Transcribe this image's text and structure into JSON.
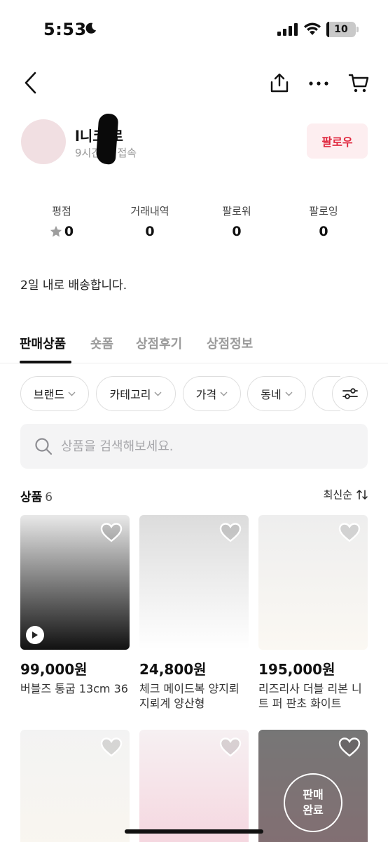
{
  "status_bar": {
    "time": "5:53",
    "battery": "10",
    "battery_level": 0.1
  },
  "profile": {
    "name": "l니코 로",
    "last_seen": "9시간 전 접속",
    "follow_label": "팔로우"
  },
  "stats": [
    {
      "label": "평점",
      "value": "0"
    },
    {
      "label": "거래내역",
      "value": "0"
    },
    {
      "label": "팔로워",
      "value": "0"
    },
    {
      "label": "팔로잉",
      "value": "0"
    }
  ],
  "intro": "2일 내로 배송합니다.",
  "tabs": [
    {
      "label": "판매상품",
      "active": true
    },
    {
      "label": "숏폼"
    },
    {
      "label": "상점후기"
    },
    {
      "label": "상점정보"
    }
  ],
  "filters": [
    {
      "label": "브랜드"
    },
    {
      "label": "카테고리"
    },
    {
      "label": "가격"
    },
    {
      "label": "동네"
    }
  ],
  "search": {
    "placeholder": "상품을 검색해보세요."
  },
  "products_header": {
    "title": "상품",
    "count": "6",
    "sort": "최신순"
  },
  "products": [
    {
      "price": "99,000원",
      "name": "버블즈 통굽 13cm 36",
      "video": true,
      "sold": false,
      "colors": [
        "#e9e9e9",
        "#111111"
      ]
    },
    {
      "price": "24,800원",
      "name": "체크 메이드복 양지뢰 지뢰계 양산형",
      "video": false,
      "sold": false,
      "colors": [
        "#dcdcdc",
        "#ffffff"
      ]
    },
    {
      "price": "195,000원",
      "name": "리즈리사 더블 리본 니트 퍼 판초 화이트",
      "video": false,
      "sold": false,
      "colors": [
        "#eeeeee",
        "#fbf8f3"
      ]
    },
    {
      "price": "",
      "name": "",
      "video": false,
      "sold": false,
      "colors": [
        "#f3f3f3",
        "#faf6ef"
      ]
    },
    {
      "price": "",
      "name": "",
      "video": false,
      "sold": false,
      "colors": [
        "#f6f0f2",
        "#f5d2dc"
      ]
    },
    {
      "price": "",
      "name": "",
      "video": false,
      "sold": true,
      "sold_label_1": "판매",
      "sold_label_2": "완료",
      "colors": [
        "#d8d8d8",
        "#f1c8cf"
      ]
    }
  ],
  "colors": {
    "accent": "#e0283f",
    "follow_bg": "#fdeef0"
  }
}
